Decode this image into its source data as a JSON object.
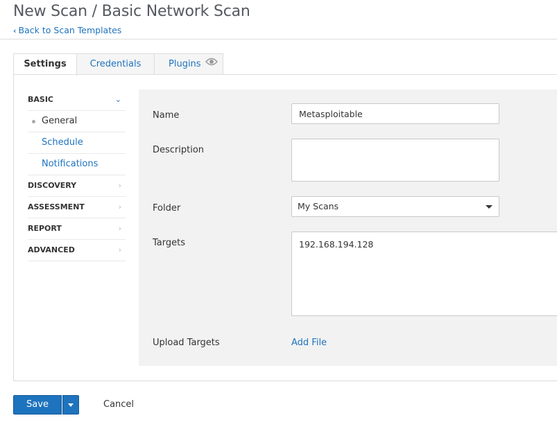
{
  "header": {
    "title": "New Scan / Basic Network Scan",
    "back_link": "Back to Scan Templates"
  },
  "tabs": [
    {
      "label": "Settings",
      "active": true
    },
    {
      "label": "Credentials",
      "active": false
    },
    {
      "label": "Plugins",
      "active": false,
      "icon": "eye-icon"
    }
  ],
  "sidebar": {
    "sections": [
      {
        "label": "BASIC",
        "expanded": true,
        "items": [
          {
            "label": "General",
            "active": true
          },
          {
            "label": "Schedule",
            "active": false
          },
          {
            "label": "Notifications",
            "active": false
          }
        ]
      },
      {
        "label": "DISCOVERY",
        "expanded": false
      },
      {
        "label": "ASSESSMENT",
        "expanded": false
      },
      {
        "label": "REPORT",
        "expanded": false
      },
      {
        "label": "ADVANCED",
        "expanded": false
      }
    ]
  },
  "form": {
    "name": {
      "label": "Name",
      "value": "Metasploitable"
    },
    "description": {
      "label": "Description",
      "value": ""
    },
    "folder": {
      "label": "Folder",
      "value": "My Scans"
    },
    "targets": {
      "label": "Targets",
      "value": "192.168.194.128"
    },
    "upload_targets": {
      "label": "Upload Targets",
      "link": "Add File"
    }
  },
  "actions": {
    "save": "Save",
    "cancel": "Cancel"
  },
  "colors": {
    "accent": "#1e73be",
    "form_background": "#f2f2f2",
    "border": "#dddddd"
  }
}
